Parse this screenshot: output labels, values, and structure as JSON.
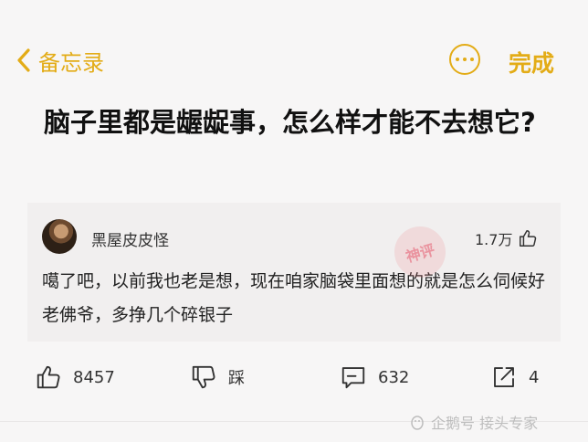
{
  "header": {
    "back_label": "备忘录",
    "done_label": "完成"
  },
  "question": {
    "title": "脑子里都是龌龊事，怎么样才能不去想它?"
  },
  "answer": {
    "username": "黑屋皮皮怪",
    "likes": "1.7万",
    "text": "噶了吧，以前我也老是想，现在咱家脑袋里面想的就是怎么伺候好老佛爷，多挣几个碎银子"
  },
  "actions": {
    "upvote_count": "8457",
    "downvote_label": "踩",
    "comment_count": "632",
    "share_count": "4"
  },
  "watermark": {
    "stamp_text": "神评",
    "text": "企鹅号 接头专家"
  },
  "colors": {
    "accent": "#e3ac17",
    "background": "#f7f6f6",
    "card": "#f1efef"
  }
}
